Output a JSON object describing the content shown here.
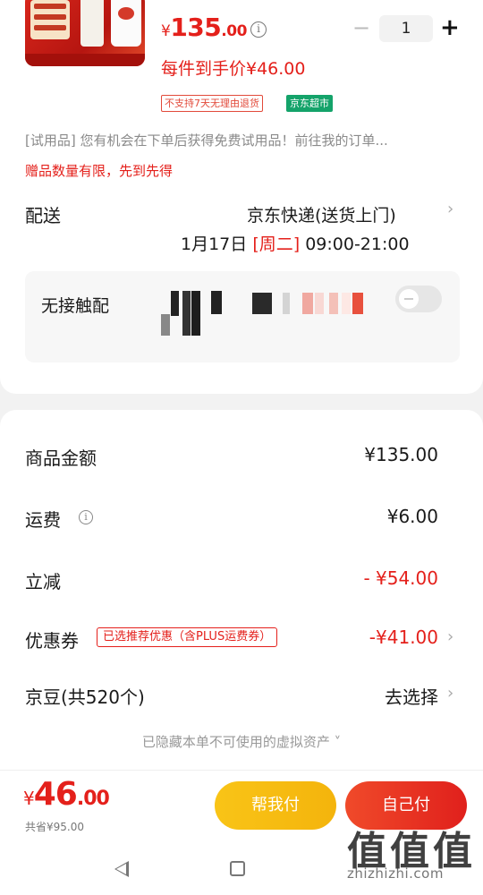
{
  "product": {
    "price_yen": "¥",
    "price_int": "135",
    "price_dec": ".00",
    "info_glyph": "i",
    "quantity": "1",
    "minus": "−",
    "plus": "+",
    "per_item_price": "每件到手价¥46.00",
    "badge_no_return": "不支持7天无理由退货",
    "badge_market": "京东超市"
  },
  "trial_notice": "[试用品] 您有机会在下单后获得免费试用品！前往我的订单...",
  "limited_notice": "赠品数量有限，先到先得",
  "delivery": {
    "label": "配送",
    "method": "京东快递(送货上门)",
    "date": "1月17日",
    "weekday": "[周二]",
    "time": "09:00-21:00"
  },
  "contactless": {
    "label": "无接触配"
  },
  "summary": {
    "goods_label": "商品金额",
    "goods_value": "¥135.00",
    "shipping_label": "运费",
    "shipping_value": "¥6.00",
    "discount_label": "立减",
    "discount_value": "- ¥54.00",
    "coupon_label": "优惠券",
    "coupon_tag": "已选推荐优惠（含PLUS运费券）",
    "coupon_value": "-¥41.00",
    "beans_label": "京豆(共520个)",
    "beans_value": "去选择",
    "hidden_assets": "已隐藏本单不可使用的虚拟资产 ˅"
  },
  "checkout": {
    "total_yen": "¥",
    "total_int": "46",
    "total_dec": ".00",
    "saved": "共省¥95.00",
    "help_pay": "帮我付",
    "self_pay": "自己付"
  },
  "watermark": {
    "glyph": "值",
    "url": "zhizhizhi.com"
  },
  "colors": {
    "accent_red": "#e4201b",
    "market_green": "#14a36a",
    "help_yellow": "#f9c417"
  }
}
